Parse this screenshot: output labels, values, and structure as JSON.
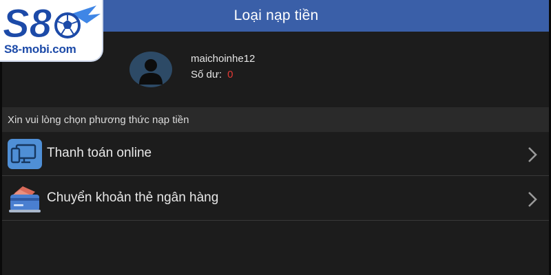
{
  "logo": {
    "brand_text": "S8-mobi.com",
    "icon": "s8-soccer-ball-logo"
  },
  "header": {
    "title": "Loại nạp tiền"
  },
  "profile": {
    "avatar_icon": "user-avatar-icon",
    "username": "maichoinhe12",
    "balance_label": "Số dư:",
    "balance_value": "0"
  },
  "section": {
    "label": "Xin vui lòng chọn phương thức nạp tiền"
  },
  "methods": [
    {
      "label": "Thanh toán online",
      "icon": "computer-icon",
      "chevron": "chevron-right-icon"
    },
    {
      "label": "Chuyển khoản thẻ ngân hàng",
      "icon": "bank-card-icon",
      "chevron": "chevron-right-icon"
    }
  ],
  "colors": {
    "header_bg": "#3a5fa8",
    "background": "#1c1c1c",
    "section_bg": "#2a2a2a",
    "balance_value": "#e53935"
  }
}
